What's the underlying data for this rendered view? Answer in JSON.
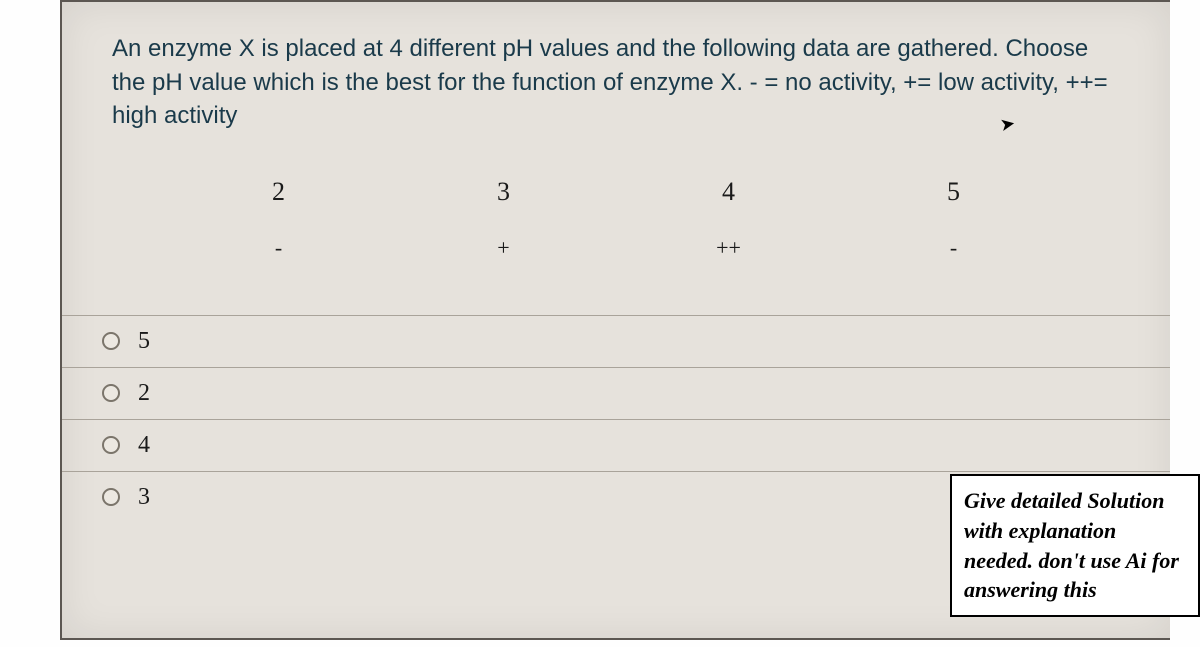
{
  "question": {
    "text": "An enzyme X is placed at 4 different pH values and the following data are gathered.  Choose the pH value which is the best for the function of enzyme X.  - = no activity, += low activity, ++= high activity"
  },
  "chart_data": {
    "type": "table",
    "headers": [
      "2",
      "3",
      "4",
      "5"
    ],
    "values": [
      "-",
      "+",
      "++",
      "-"
    ],
    "legend": {
      "-": "no activity",
      "+": "low activity",
      "++": "high activity"
    }
  },
  "options": [
    {
      "label": "5"
    },
    {
      "label": "2"
    },
    {
      "label": "4"
    },
    {
      "label": "3"
    }
  ],
  "note": "Give detailed Solution with explanation needed. don't use Ai for answering this"
}
